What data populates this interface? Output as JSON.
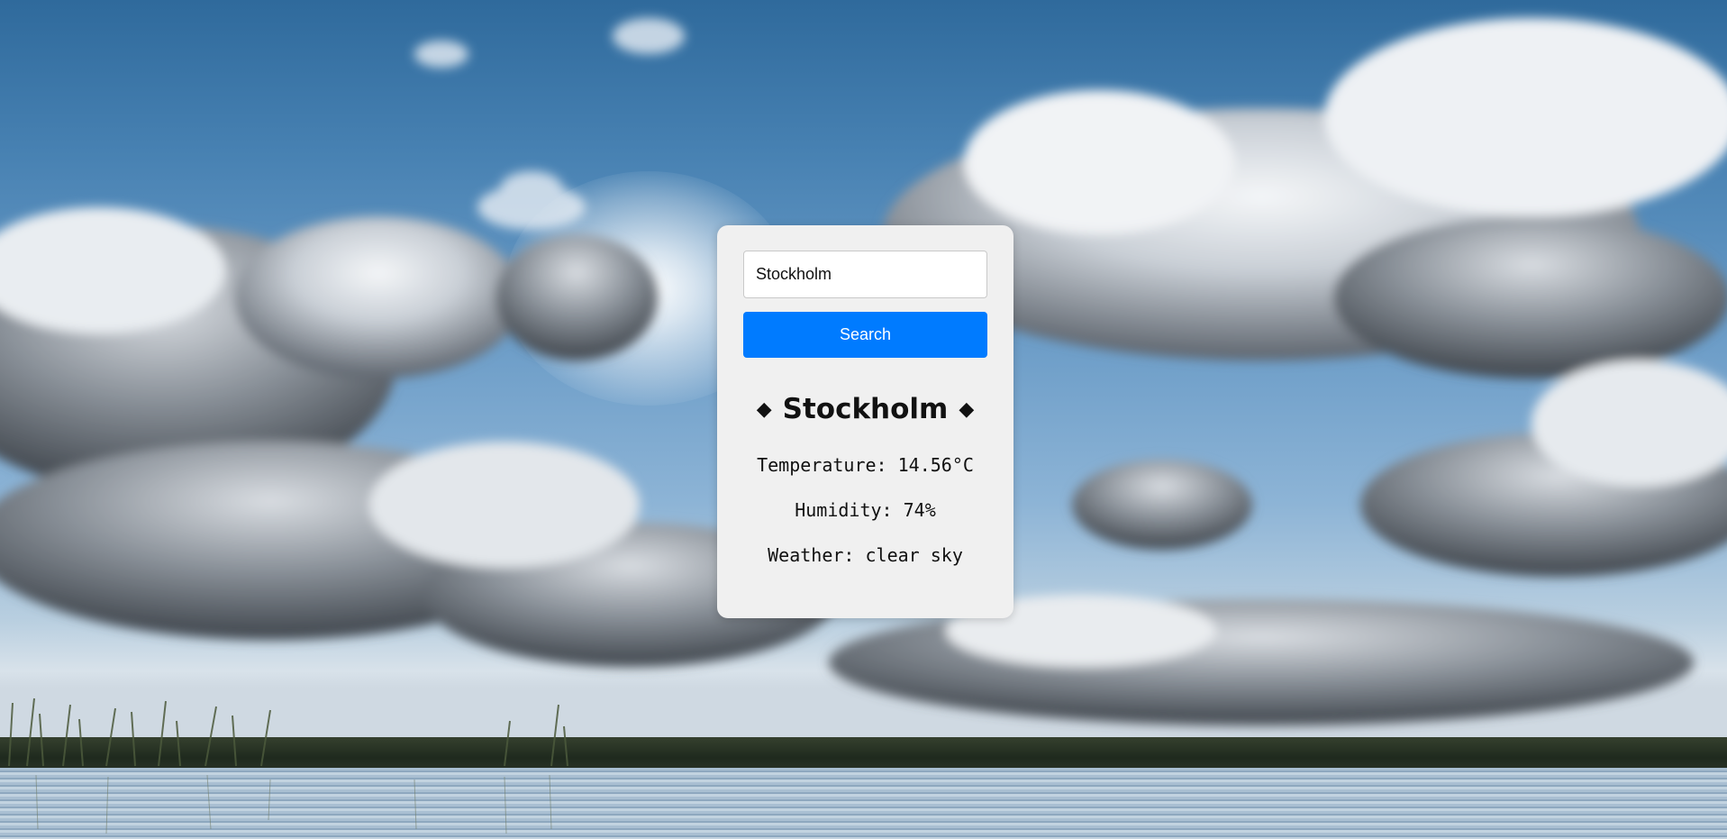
{
  "search": {
    "value": "Stockholm",
    "button_label": "Search"
  },
  "result": {
    "city": "Stockholm",
    "diamond": "◆",
    "temperature_text": "Temperature: 14.56°C",
    "humidity_text": "Humidity: 74%",
    "weather_text": "Weather: clear sky"
  },
  "colors": {
    "accent": "#007bff",
    "card_background": "#f0f0f0"
  }
}
